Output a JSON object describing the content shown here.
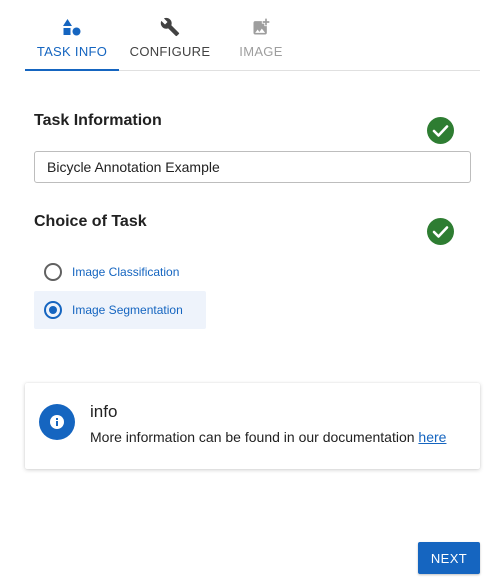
{
  "tabs": [
    {
      "label": "TASK INFO",
      "icon": "shapes-icon",
      "state": "active"
    },
    {
      "label": "CONFIGURE",
      "icon": "wrench-icon",
      "state": "enabled"
    },
    {
      "label": "IMAGE",
      "icon": "add-image-icon",
      "state": "disabled"
    }
  ],
  "task_info": {
    "title": "Task Information",
    "input_value": "Bicycle Annotation Example",
    "status_icon": "check-circle-icon"
  },
  "task_choice": {
    "title": "Choice of Task",
    "status_icon": "check-circle-icon",
    "options": [
      {
        "label": "Image Classification",
        "selected": false
      },
      {
        "label": "Image Segmentation",
        "selected": true
      }
    ]
  },
  "info_card": {
    "icon": "info-icon",
    "title": "info",
    "text": "More information can be found in our documentation ",
    "link_label": "here"
  },
  "footer": {
    "next_label": "NEXT"
  },
  "colors": {
    "accent": "#1565c0",
    "success": "#2e7d32",
    "disabled": "#9e9e9e"
  }
}
